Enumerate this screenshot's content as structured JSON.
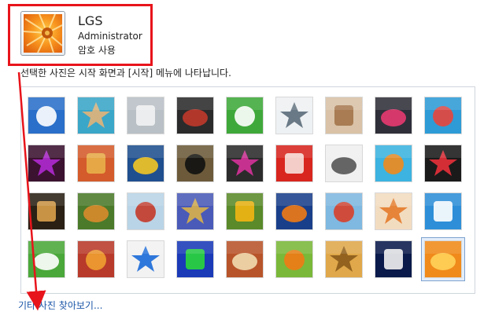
{
  "user": {
    "name": "LGS",
    "role": "Administrator",
    "password_status": "암호 사용"
  },
  "instruction": "선택한 사진은 시작 화면과 [시작] 메뉴에 나타납니다.",
  "pictures": [
    {
      "name": "roller-coaster",
      "bg": "#2a6fc9",
      "fg": "#ffffff"
    },
    {
      "name": "starfish",
      "bg": "#3aa6c8",
      "fg": "#e2b478"
    },
    {
      "name": "robot-toy",
      "bg": "#b9c0c6",
      "fg": "#f2f2f2"
    },
    {
      "name": "turntable",
      "bg": "#2b2b2b",
      "fg": "#c0392b"
    },
    {
      "name": "lucky-cat",
      "bg": "#3ea93a",
      "fg": "#ffffff"
    },
    {
      "name": "gyroscope",
      "bg": "#eef1f3",
      "fg": "#5a6b7a"
    },
    {
      "name": "kitten",
      "bg": "#d9c2a7",
      "fg": "#a3744a"
    },
    {
      "name": "pink-flower",
      "bg": "#2f2f3a",
      "fg": "#e83a70"
    },
    {
      "name": "pinwheel",
      "bg": "#2e9bd6",
      "fg": "#e8453c"
    },
    {
      "name": "pool-ball",
      "bg": "#3b1230",
      "fg": "#b02ad1"
    },
    {
      "name": "fabric-stripes",
      "bg": "#d45b2b",
      "fg": "#e8b04a"
    },
    {
      "name": "yellow-leaf",
      "bg": "#1f4f8f",
      "fg": "#f2c524"
    },
    {
      "name": "border-collie",
      "bg": "#6c5a3a",
      "fg": "#111111"
    },
    {
      "name": "crayons",
      "bg": "#2b2b2b",
      "fg": "#d6329a"
    },
    {
      "name": "paper-star",
      "bg": "#d8251e",
      "fg": "#f7e0dc"
    },
    {
      "name": "jacks",
      "bg": "#f0f0f0",
      "fg": "#555555"
    },
    {
      "name": "stairs",
      "bg": "#3cb3e0",
      "fg": "#f08a1c"
    },
    {
      "name": "paper-crane",
      "bg": "#1a1a1a",
      "fg": "#e8303a"
    },
    {
      "name": "guitar",
      "bg": "#2a2014",
      "fg": "#d9a04a"
    },
    {
      "name": "pomeranian",
      "bg": "#4a7a2a",
      "fg": "#d98b2b"
    },
    {
      "name": "tin-robot",
      "bg": "#b9d4e6",
      "fg": "#c43a2a"
    },
    {
      "name": "silk-scarves",
      "bg": "#4a5ab8",
      "fg": "#d8b04a"
    },
    {
      "name": "sunflower",
      "bg": "#5a8a2a",
      "fg": "#f3b512"
    },
    {
      "name": "clownfish",
      "bg": "#1a3f8a",
      "fg": "#f07a14"
    },
    {
      "name": "hot-air-balloon",
      "bg": "#7fb8e0",
      "fg": "#d8402a"
    },
    {
      "name": "kokeshi-doll",
      "bg": "#f2dcc0",
      "fg": "#e47a2a"
    },
    {
      "name": "sailboat",
      "bg": "#2e8fd8",
      "fg": "#ffffff"
    },
    {
      "name": "soccer-ball",
      "bg": "#4aa83a",
      "fg": "#ffffff"
    },
    {
      "name": "woven-fabric",
      "bg": "#b83a2a",
      "fg": "#f0a030"
    },
    {
      "name": "marbles",
      "bg": "#f2f2f2",
      "fg": "#1a6ad8"
    },
    {
      "name": "green-window",
      "bg": "#1a3ab8",
      "fg": "#2ad83a"
    },
    {
      "name": "tribal-pattern",
      "bg": "#b8542a",
      "fg": "#f2dcb0"
    },
    {
      "name": "butterfly",
      "bg": "#7ab83a",
      "fg": "#f07a14"
    },
    {
      "name": "wicker",
      "bg": "#e0a84a",
      "fg": "#8a5a1a"
    },
    {
      "name": "lighthouse",
      "bg": "#0a1a4a",
      "fg": "#f2f2f2"
    },
    {
      "name": "orange-flower",
      "bg": "#f08a1a",
      "fg": "#ffd25a",
      "selected": true
    }
  ],
  "more_link": "기타 사진 찾아보기...",
  "colors": {
    "annotation": "#e8141b",
    "link": "#1a55a7"
  }
}
